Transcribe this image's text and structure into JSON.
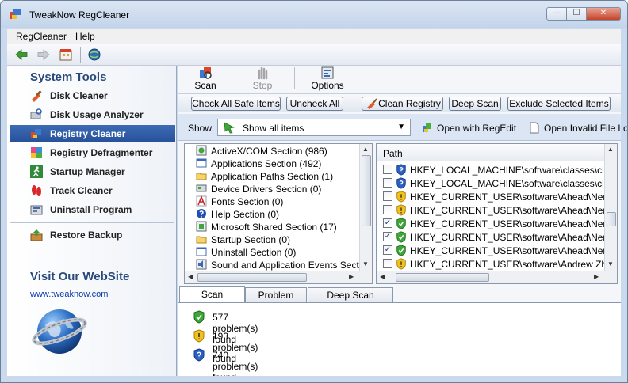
{
  "window": {
    "title": "TweakNow RegCleaner",
    "min_glyph": "—",
    "max_glyph": "☐",
    "close_glyph": "✕"
  },
  "menu": [
    "RegCleaner",
    "Help"
  ],
  "sidebar": {
    "system_tools_heading": "System Tools",
    "items": [
      {
        "label": "Disk Cleaner",
        "active": false
      },
      {
        "label": "Disk Usage Analyzer",
        "active": false
      },
      {
        "label": "Registry Cleaner",
        "active": true
      },
      {
        "label": "Registry Defragmenter",
        "active": false
      },
      {
        "label": "Startup Manager",
        "active": false
      },
      {
        "label": "Track Cleaner",
        "active": false
      },
      {
        "label": "Uninstall Program",
        "active": false
      }
    ],
    "restore_label": "Restore Backup",
    "website_heading": "Visit Our WebSite",
    "website_link": "www.tweaknow.com"
  },
  "commands": {
    "scan": "Scan Registry",
    "stop": "Stop",
    "options": "Options"
  },
  "actions": {
    "check_all_safe": "Check All Safe Items",
    "uncheck_all": "Uncheck All",
    "clean_registry": "Clean Registry",
    "deep_scan": "Deep Scan",
    "exclude_selected": "Exclude Selected Items"
  },
  "show": {
    "label": "Show",
    "selected": "Show all items",
    "open_regedit": "Open with RegEdit",
    "open_invalid": "Open Invalid File Lo"
  },
  "sections": [
    "ActiveX/COM Section (986)",
    "Applications Section (492)",
    "Application Paths Section (1)",
    "Device Drivers Section (0)",
    "Fonts Section (0)",
    "Help Section (0)",
    "Microsoft Shared Section (17)",
    "Startup Section (0)",
    "Uninstall Section (0)",
    "Sound and Application Events Section ("
  ],
  "paths": {
    "header": "Path",
    "rows": [
      {
        "text": "HKEY_LOCAL_MACHINE\\software\\classes\\clsid\\{FE",
        "checked": false,
        "level": "blue"
      },
      {
        "text": "HKEY_LOCAL_MACHINE\\software\\classes\\clsid\\{FE",
        "checked": false,
        "level": "blue"
      },
      {
        "text": "HKEY_CURRENT_USER\\software\\Ahead\\Nero - Burn",
        "checked": false,
        "level": "yellow"
      },
      {
        "text": "HKEY_CURRENT_USER\\software\\Ahead\\Nero - Burn",
        "checked": false,
        "level": "yellow"
      },
      {
        "text": "HKEY_CURRENT_USER\\software\\Ahead\\Nero - Burn",
        "checked": true,
        "level": "green"
      },
      {
        "text": "HKEY_CURRENT_USER\\software\\Ahead\\Nero - Burn",
        "checked": true,
        "level": "green"
      },
      {
        "text": "HKEY_CURRENT_USER\\software\\Ahead\\Nero - Burn",
        "checked": true,
        "level": "green"
      },
      {
        "text": "HKEY_CURRENT_USER\\software\\Andrew Zhezheru",
        "checked": false,
        "level": "yellow"
      }
    ]
  },
  "tabs": [
    "Scan Summary",
    "Problem Detail",
    "Deep Scan Summary"
  ],
  "summary": [
    "577 problem(s) found",
    "193 problem(s) found",
    "740 problem(s) found"
  ],
  "colors": {
    "accent": "#2f5ea8",
    "safe": "#3ea63a",
    "caution": "#f2c21b",
    "info": "#2b5fc4"
  }
}
